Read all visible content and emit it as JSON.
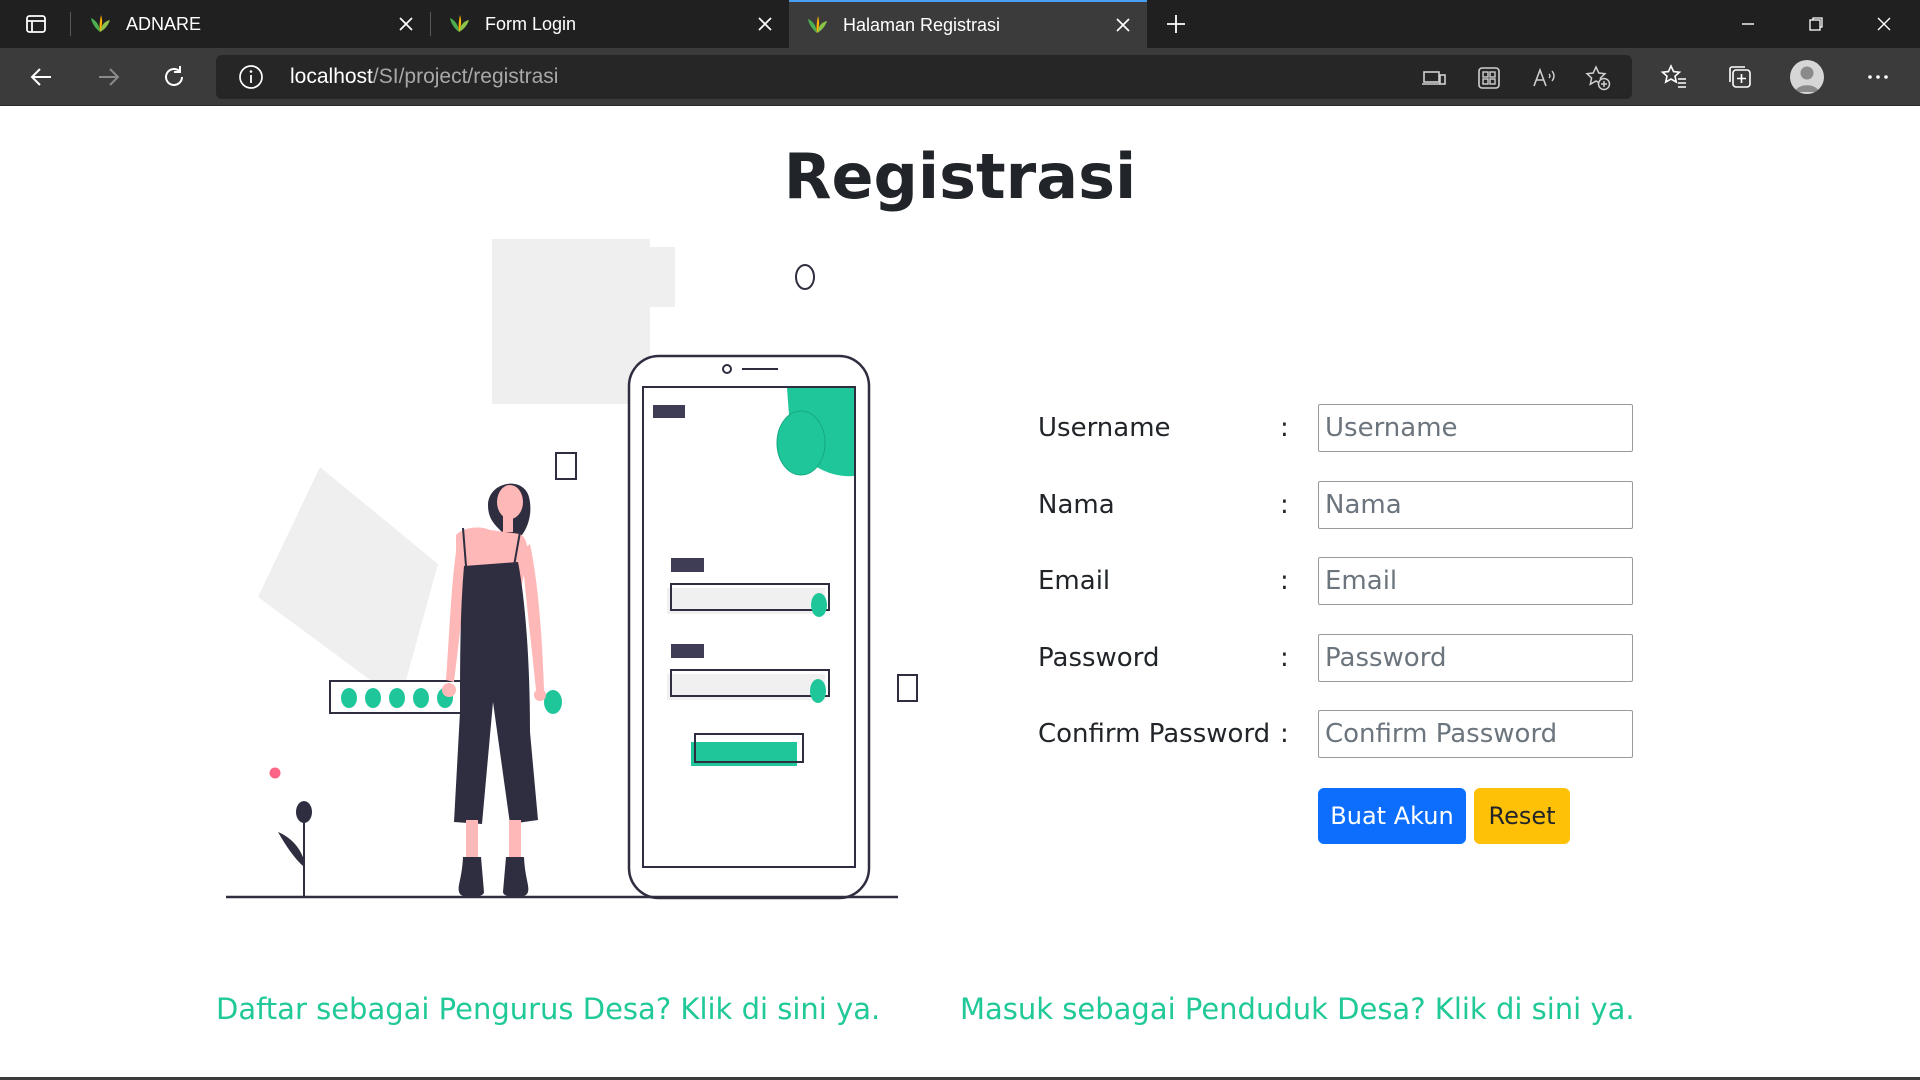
{
  "browser": {
    "tabs": [
      {
        "title": "ADNARE",
        "active": false
      },
      {
        "title": "Form Login",
        "active": false
      },
      {
        "title": "Halaman Registrasi",
        "active": true
      }
    ],
    "address": {
      "host": "localhost",
      "path": "/SI/project/registrasi"
    }
  },
  "page": {
    "title": "Registrasi"
  },
  "form": {
    "separator": ":",
    "fields": [
      {
        "label": "Username",
        "placeholder": "Username",
        "value": ""
      },
      {
        "label": "Nama",
        "placeholder": "Nama",
        "value": ""
      },
      {
        "label": "Email",
        "placeholder": "Email",
        "value": ""
      },
      {
        "label": "Password",
        "placeholder": "Password",
        "value": ""
      },
      {
        "label": "Confirm Password",
        "placeholder": "Confirm Password",
        "value": ""
      }
    ],
    "submit_label": "Buat Akun",
    "reset_label": "Reset"
  },
  "links": {
    "pengurus": "Daftar sebagai Pengurus Desa? Klik di sini ya.",
    "penduduk": "Masuk sebagai Penduduk Desa? Klik di sini ya."
  },
  "colors": {
    "accent_green": "#20c997",
    "primary": "#0d6efd",
    "warning": "#ffc107",
    "illustration_dark": "#2f2e41",
    "illustration_green": "#1fc69a"
  },
  "icons": [
    "tab-actions-icon",
    "leaf-favicon-icon",
    "close-icon",
    "plus-icon",
    "minimize-icon",
    "restore-icon",
    "back-icon",
    "forward-icon",
    "refresh-icon",
    "info-icon",
    "devices-icon",
    "apps-icon",
    "read-aloud-icon",
    "favorite-add-icon",
    "favorites-icon",
    "collections-icon",
    "profile-avatar-icon",
    "more-icon"
  ]
}
